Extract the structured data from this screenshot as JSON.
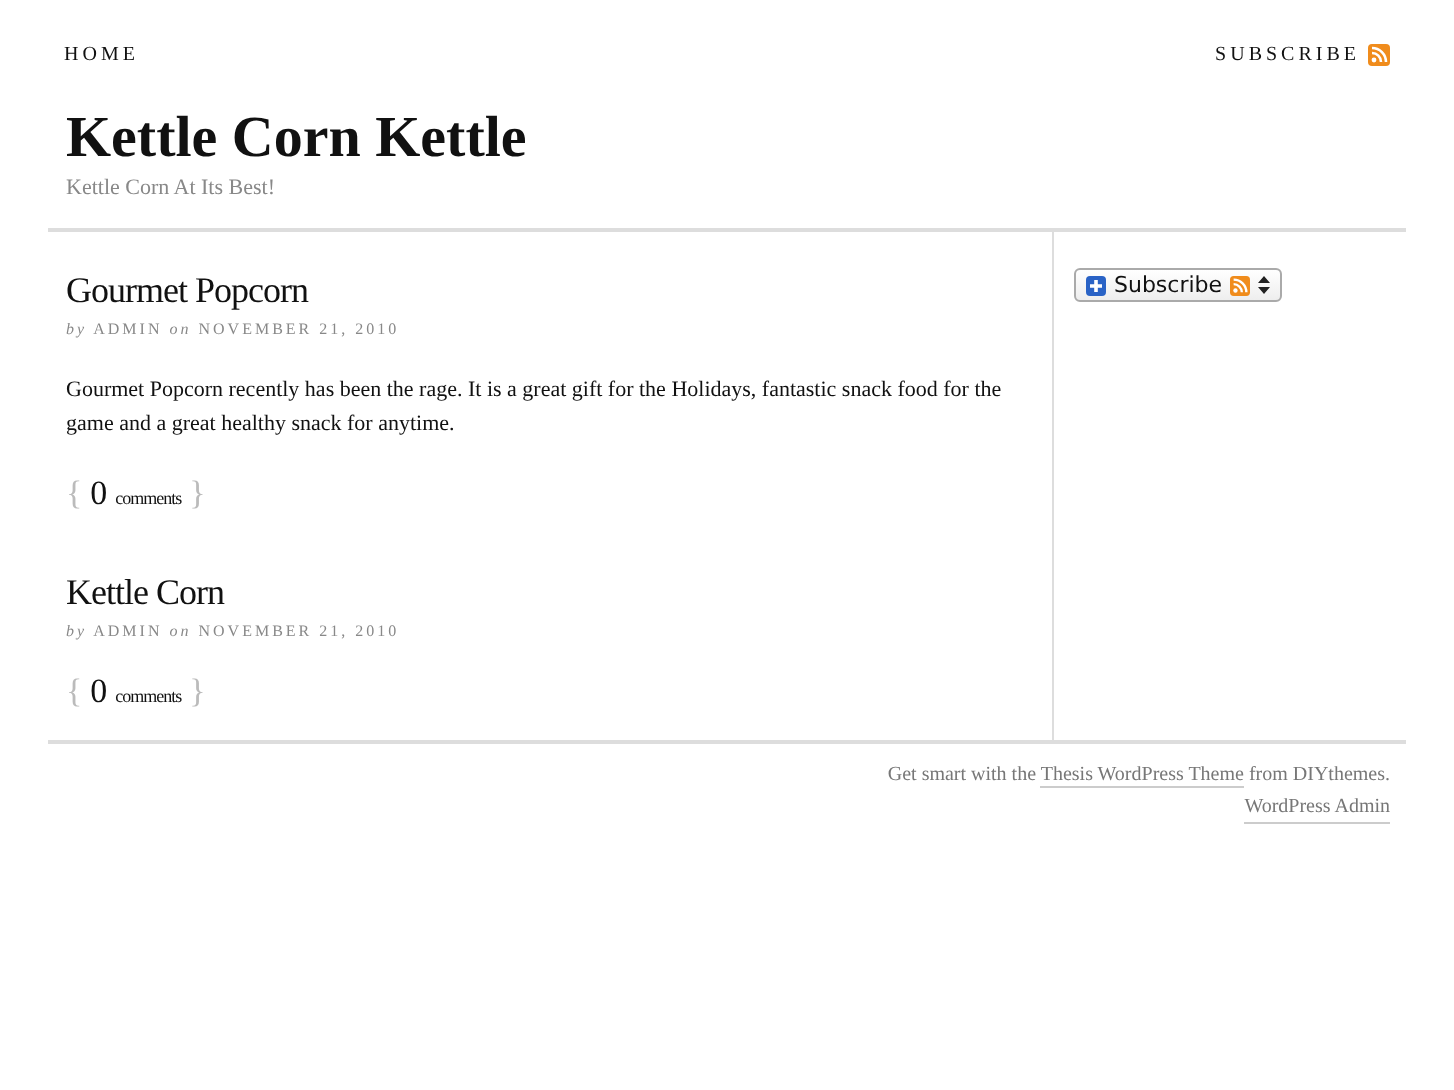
{
  "nav": {
    "home": "HOME",
    "subscribe": "SUBSCRIBE"
  },
  "header": {
    "title": "Kettle Corn Kettle",
    "tagline": "Kettle Corn At Its Best!"
  },
  "posts": [
    {
      "title": "Gourmet Popcorn",
      "meta": "*by* ADMIN *on* NOVEMBER 21, 2010",
      "body": "Gourmet Popcorn recently has been the rage. It is a great gift for the Holidays, fantastic snack food for the game and a great healthy snack for anytime.",
      "comments": {
        "open": "{",
        "count": "0",
        "label": "comments",
        "close": "}"
      }
    },
    {
      "title": "Kettle Corn",
      "meta": "*by* ADMIN *on* NOVEMBER 21, 2010",
      "comments": {
        "open": "{",
        "count": "0",
        "label": "comments",
        "close": "}"
      }
    }
  ],
  "sidebar": {
    "subscribe_button": "Subscribe"
  },
  "footer": {
    "text_before": "Get smart with the",
    "link_theme": "Thesis WordPress Theme",
    "text_after": "from DIYthemes.",
    "admin_link": "WordPress Admin"
  }
}
